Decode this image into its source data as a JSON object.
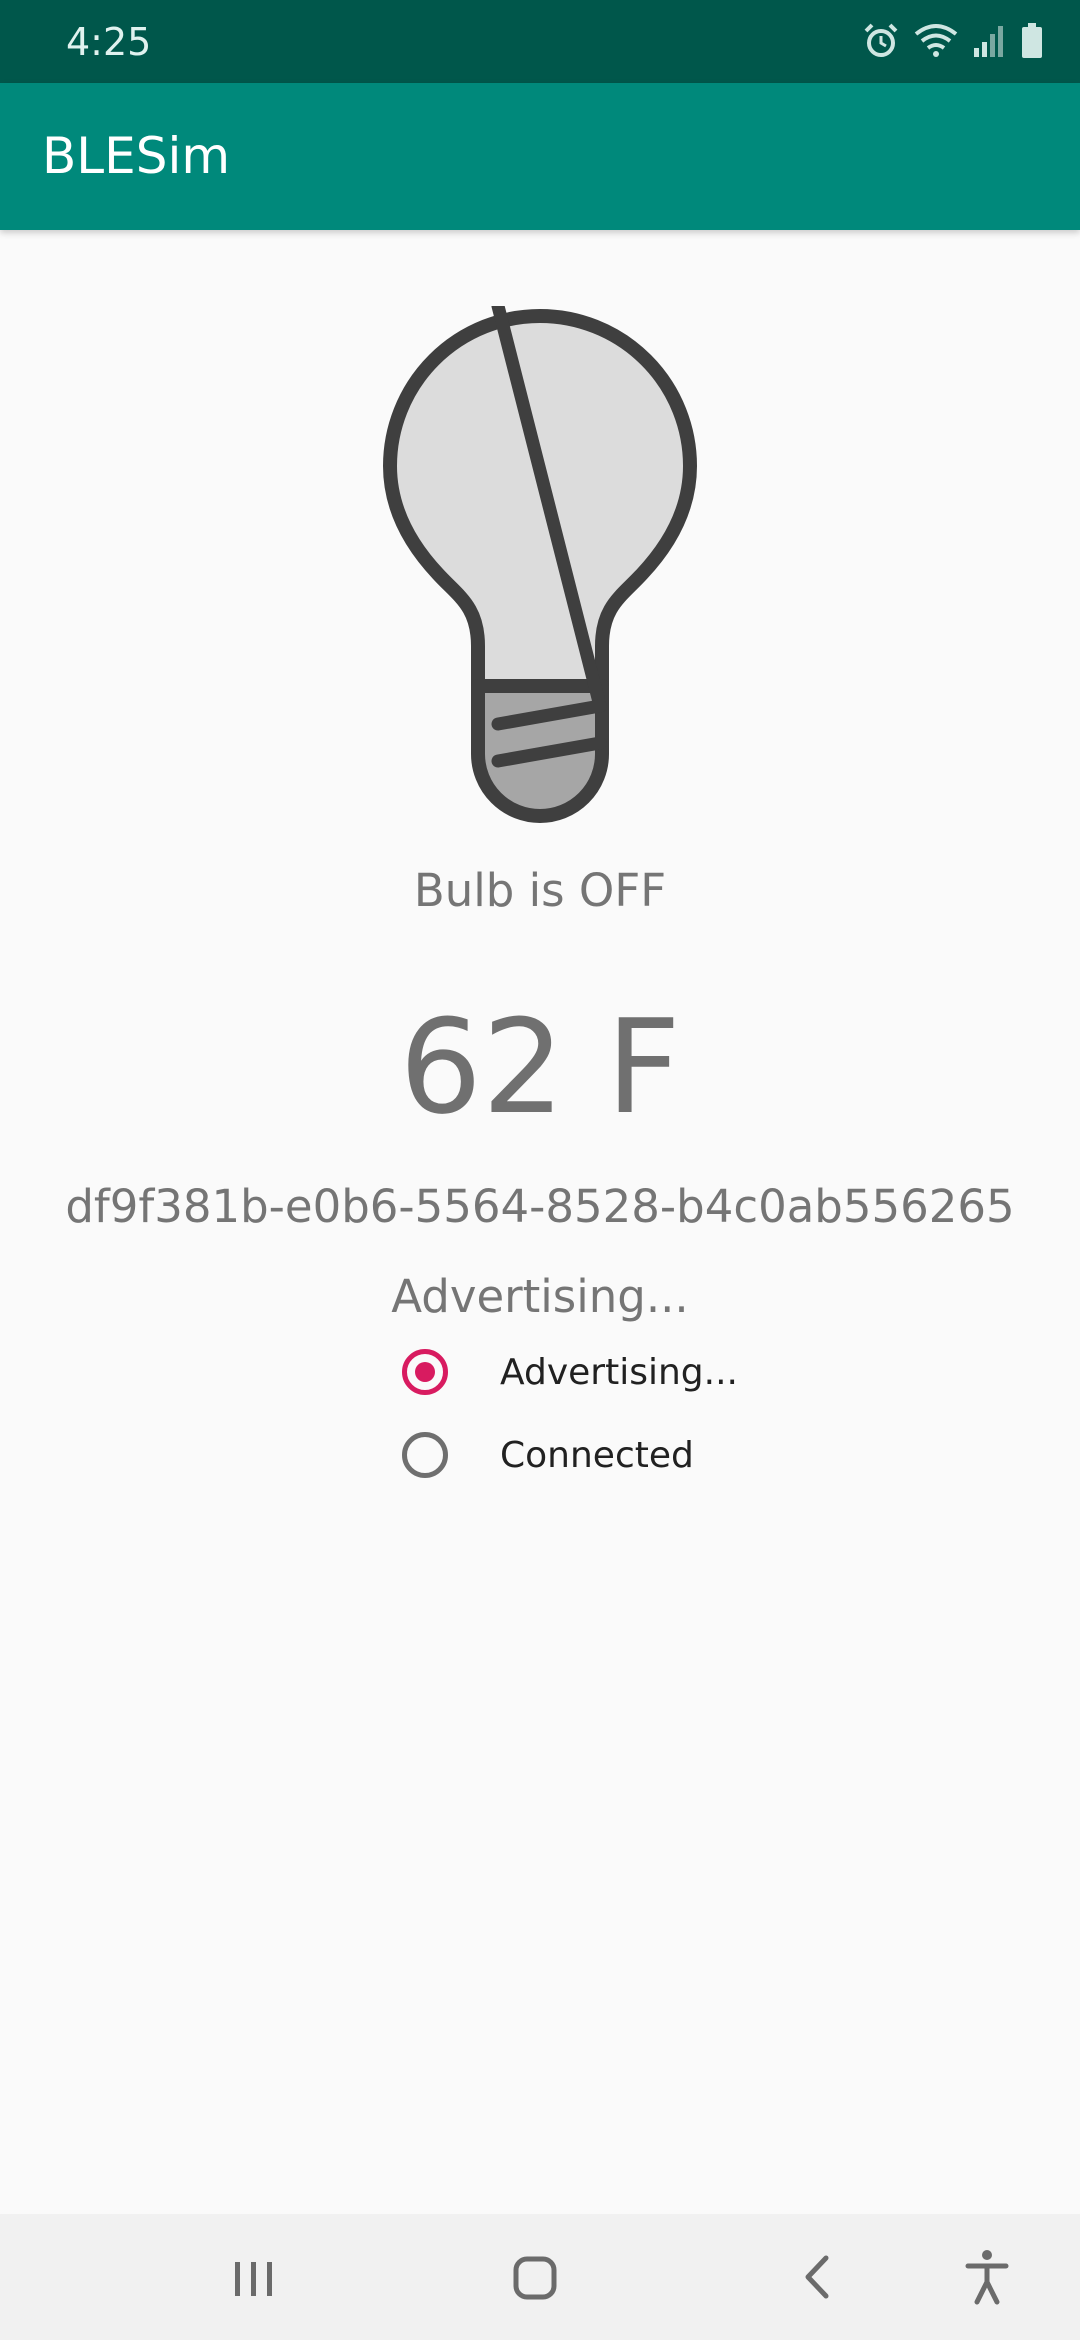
{
  "status_bar": {
    "time": "4:25",
    "icons": [
      "alarm-icon",
      "wifi-icon",
      "signal-icon",
      "battery-icon"
    ]
  },
  "app_bar": {
    "title": "BLESim"
  },
  "bulb": {
    "state_text": "Bulb is OFF"
  },
  "temperature": {
    "text": "62 F"
  },
  "device": {
    "id": "df9f381b-e0b6-5564-8528-b4c0ab556265"
  },
  "connection": {
    "status_text": "Advertising...",
    "options": [
      {
        "label": "Advertising...",
        "checked": true
      },
      {
        "label": "Connected",
        "checked": false
      }
    ]
  },
  "nav_bar": {
    "buttons": [
      "recent-apps-icon",
      "home-icon",
      "back-icon",
      "accessibility-icon"
    ]
  },
  "colors": {
    "status_bar": "#00574b",
    "app_bar": "#00897b",
    "accent": "#d81b60",
    "background": "#fafafa"
  }
}
